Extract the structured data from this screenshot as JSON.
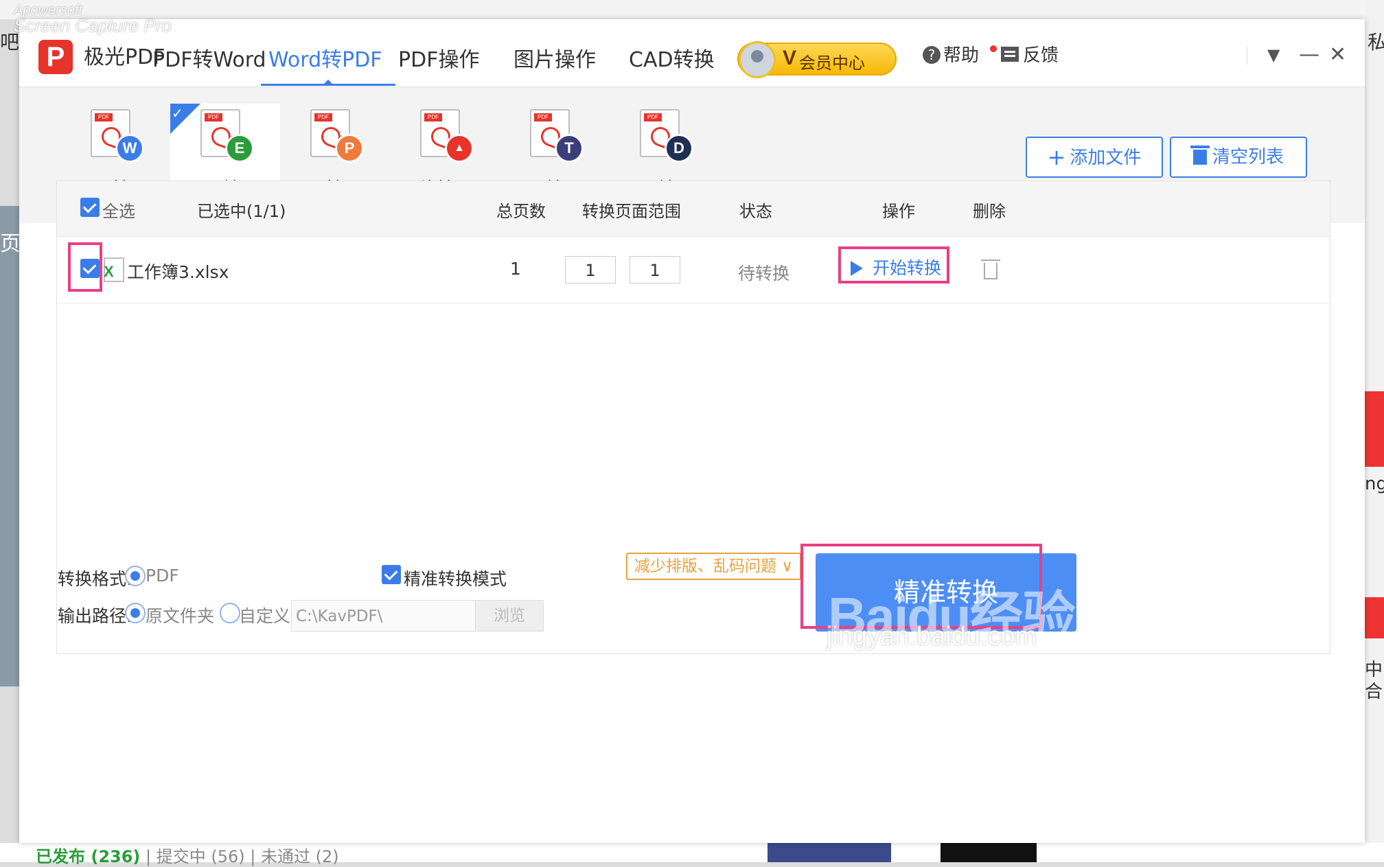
{
  "watermark": {
    "line1": "Apowersoft",
    "line2": "Screen Capture Pro"
  },
  "background": {
    "left_fragment": "吧",
    "left_strip_fragment": "页",
    "right_fragment": "私",
    "right_ng": "ng",
    "right_zh1": "中",
    "right_zh2": "合",
    "bottom_published": "已发布 (236)",
    "bottom_submitting": "提交中 (56)",
    "bottom_rejected": "未通过 (2)"
  },
  "app": {
    "name": "极光PDF",
    "logo_letter": "P",
    "nav_tabs": [
      {
        "label": "PDF转Word",
        "active": false
      },
      {
        "label": "Word转PDF",
        "active": true
      },
      {
        "label": "PDF操作",
        "active": false
      },
      {
        "label": "图片操作",
        "active": false
      },
      {
        "label": "CAD转换",
        "active": false
      }
    ],
    "vip_mark": "V",
    "vip_label": "会员中心",
    "help_label": "帮助",
    "help_icon_glyph": "?",
    "feedback_label": "反馈",
    "window_controls": {
      "menu": "▼",
      "minimize": "—",
      "close": "✕"
    }
  },
  "sub_tools": [
    {
      "label": "Word转PDF",
      "badge": "W",
      "badge_color": "#3b7de8",
      "active": false
    },
    {
      "label": "Excel转PDF",
      "badge": "E",
      "badge_color": "#2a9d3a",
      "active": true
    },
    {
      "label": "PPT转PDF",
      "badge": "P",
      "badge_color": "#ef7a3c",
      "active": false
    },
    {
      "label": "图片转PDF",
      "badge": "▲",
      "badge_color": "#e8332a",
      "active": false
    },
    {
      "label": "TXT转PDF",
      "badge": "T",
      "badge_color": "#3a3f7a",
      "active": false
    },
    {
      "label": "CAD转PDF",
      "badge": "D",
      "badge_color": "#1f2f55",
      "active": false
    }
  ],
  "actions": {
    "add_file": "添加文件",
    "add_icon": "+",
    "clear_list": "清空列表"
  },
  "table": {
    "select_all": "全选",
    "selected_count": "已选中(1/1)",
    "headers": {
      "total_pages": "总页数",
      "page_range": "转换页面范围",
      "status": "状态",
      "operation": "操作",
      "delete": "删除"
    },
    "rows": [
      {
        "file_name": "工作簿3.xlsx",
        "total_pages": "1",
        "range_from": "1",
        "range_to": "1",
        "status": "待转换",
        "action": "开始转换",
        "checked": true
      }
    ]
  },
  "settings": {
    "format_label": "转换格式:",
    "format_option": "PDF",
    "precise_mode_label": "精准转换模式",
    "precise_tag": "减少排版、乱码问题 ∨",
    "output_label": "输出路径:",
    "output_original": "原文件夹",
    "output_custom": "自定义",
    "output_path": "C:\\KavPDF\\",
    "browse": "浏览",
    "convert_button": "精准转换"
  },
  "baidu_watermark": {
    "logo": "Baidu经验",
    "url": "jingyan.baidu.com"
  },
  "colors": {
    "accent": "#3b7de8",
    "brand_red": "#e8332a",
    "highlight": "#ea3f84",
    "tag_orange": "#e9a23b"
  }
}
